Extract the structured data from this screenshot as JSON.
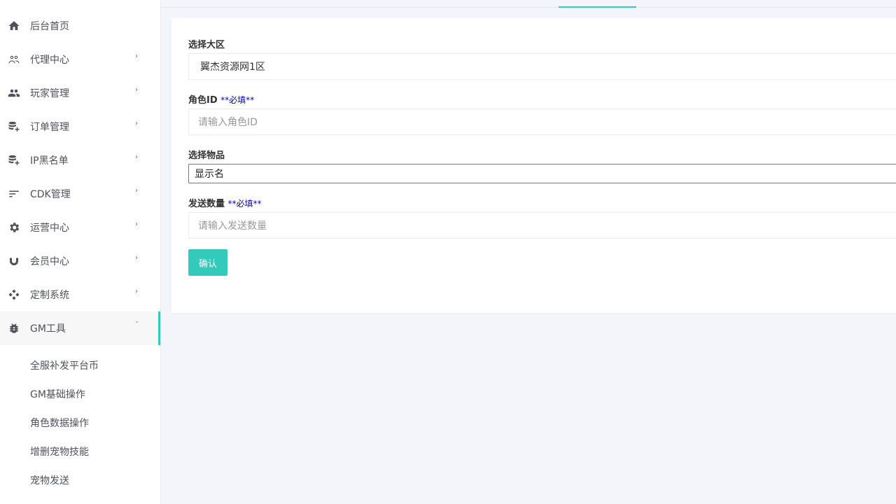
{
  "sidebar": {
    "items": [
      {
        "label": "后台首页",
        "icon": "home-icon",
        "chevron": ""
      },
      {
        "label": "代理中心",
        "icon": "agents-icon",
        "chevron": "›"
      },
      {
        "label": "玩家管理",
        "icon": "players-icon",
        "chevron": "›"
      },
      {
        "label": "订单管理",
        "icon": "database-add-icon",
        "chevron": "›"
      },
      {
        "label": "IP黑名单",
        "icon": "database-add-icon",
        "chevron": "›"
      },
      {
        "label": "CDK管理",
        "icon": "sort-icon",
        "chevron": "›"
      },
      {
        "label": "运营中心",
        "icon": "gear-icon",
        "chevron": "›"
      },
      {
        "label": "会员中心",
        "icon": "magnet-icon",
        "chevron": "›"
      },
      {
        "label": "定制系统",
        "icon": "diamonds-icon",
        "chevron": "›"
      },
      {
        "label": "GM工具",
        "icon": "bug-icon",
        "chevron": "ˇ"
      }
    ],
    "submenu": [
      "全服补发平台币",
      "GM基础操作",
      "角色数据操作",
      "增删宠物技能",
      "宠物发送"
    ]
  },
  "colors": {
    "accent": "#33cabb",
    "required": "#0000cc"
  },
  "form": {
    "region_label": "选择大区",
    "region_value": "翼杰资源网1区",
    "role_label": "角色ID",
    "role_required": "**必填**",
    "role_placeholder": "请输入角色ID",
    "item_label": "选择物品",
    "item_value": "显示名",
    "qty_label": "发送数量",
    "qty_required": "**必填**",
    "qty_placeholder": "请输入发送数量",
    "confirm_label": "确认"
  }
}
